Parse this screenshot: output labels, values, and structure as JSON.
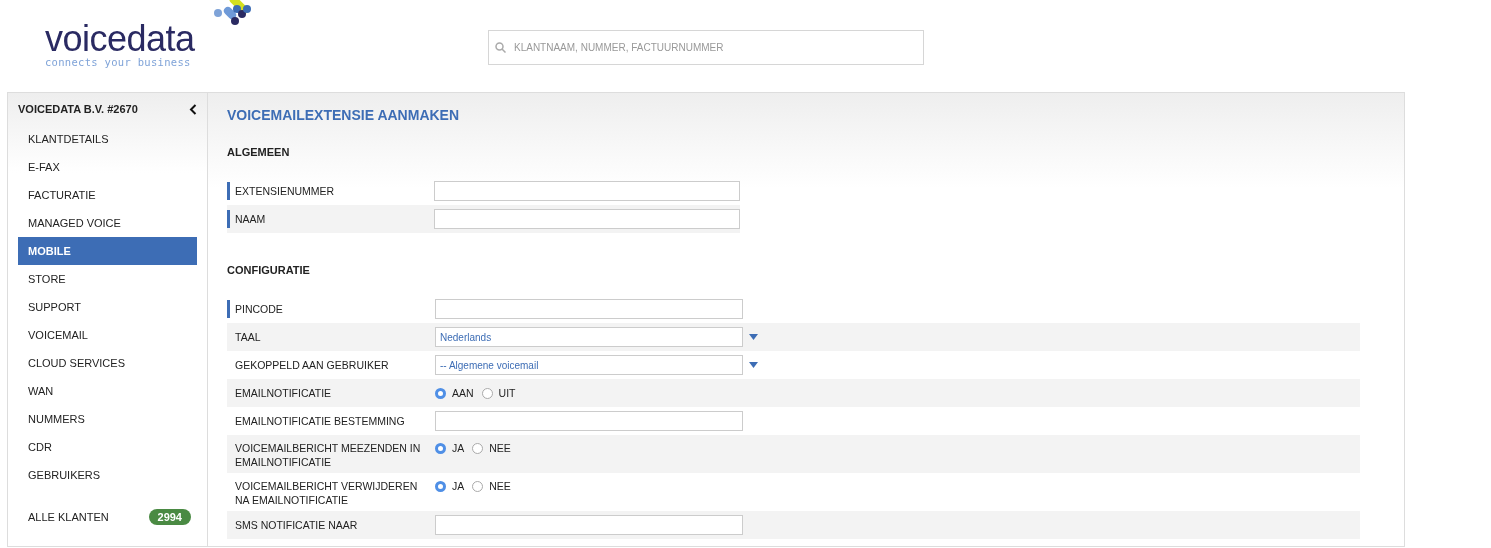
{
  "logo": {
    "name": "voicedata",
    "tagline": "connects your business"
  },
  "search": {
    "placeholder": "KLANTNAAM, NUMMER, FACTUURNUMMER"
  },
  "sidebar": {
    "title": "VOICEDATA B.V. #2670",
    "items": [
      {
        "label": "KLANTDETAILS",
        "selected": false
      },
      {
        "label": "E-FAX",
        "selected": false
      },
      {
        "label": "FACTURATIE",
        "selected": false
      },
      {
        "label": "MANAGED VOICE",
        "selected": false
      },
      {
        "label": "MOBILE",
        "selected": true
      },
      {
        "label": "STORE",
        "selected": false
      },
      {
        "label": "SUPPORT",
        "selected": false
      },
      {
        "label": "VOICEMAIL",
        "selected": false
      },
      {
        "label": "CLOUD SERVICES",
        "selected": false
      },
      {
        "label": "WAN",
        "selected": false
      },
      {
        "label": "NUMMERS",
        "selected": false
      },
      {
        "label": "CDR",
        "selected": false
      },
      {
        "label": "GEBRUIKERS",
        "selected": false
      }
    ],
    "footer": {
      "label": "ALLE KLANTEN",
      "count": "2994"
    }
  },
  "page": {
    "title": "VOICEMAILEXTENSIE AANMAKEN",
    "sections": [
      {
        "title": "ALGEMEEN",
        "fields": [
          {
            "kind": "text",
            "label": "EXTENSIENUMMER",
            "required": true
          },
          {
            "kind": "text",
            "label": "NAAM",
            "required": true
          }
        ]
      },
      {
        "title": "CONFIGURATIE",
        "fields": [
          {
            "kind": "text",
            "label": "PINCODE",
            "required": true
          },
          {
            "kind": "select",
            "label": "TAAL",
            "required": false,
            "value": "Nederlands"
          },
          {
            "kind": "select",
            "label": "GEKOPPELD AAN GEBRUIKER",
            "required": false,
            "value": "-- Algemene voicemail"
          },
          {
            "kind": "radio",
            "label": "EMAILNOTIFICATIE",
            "required": false,
            "options": [
              {
                "label": "AAN",
                "selected": true
              },
              {
                "label": "UIT",
                "selected": false
              }
            ]
          },
          {
            "kind": "text",
            "label": "EMAILNOTIFICATIE BESTEMMING",
            "required": false
          },
          {
            "kind": "radio",
            "label": "VOICEMAILBERICHT MEEZENDEN IN EMAILNOTIFICATIE",
            "required": false,
            "options": [
              {
                "label": "JA",
                "selected": true
              },
              {
                "label": "NEE",
                "selected": false
              }
            ]
          },
          {
            "kind": "radio",
            "label": "VOICEMAILBERICHT VERWIJDEREN NA EMAILNOTIFICATIE",
            "required": false,
            "options": [
              {
                "label": "JA",
                "selected": true
              },
              {
                "label": "NEE",
                "selected": false
              }
            ]
          },
          {
            "kind": "text",
            "label": "SMS NOTIFICATIE NAAR",
            "required": false
          }
        ]
      }
    ]
  }
}
